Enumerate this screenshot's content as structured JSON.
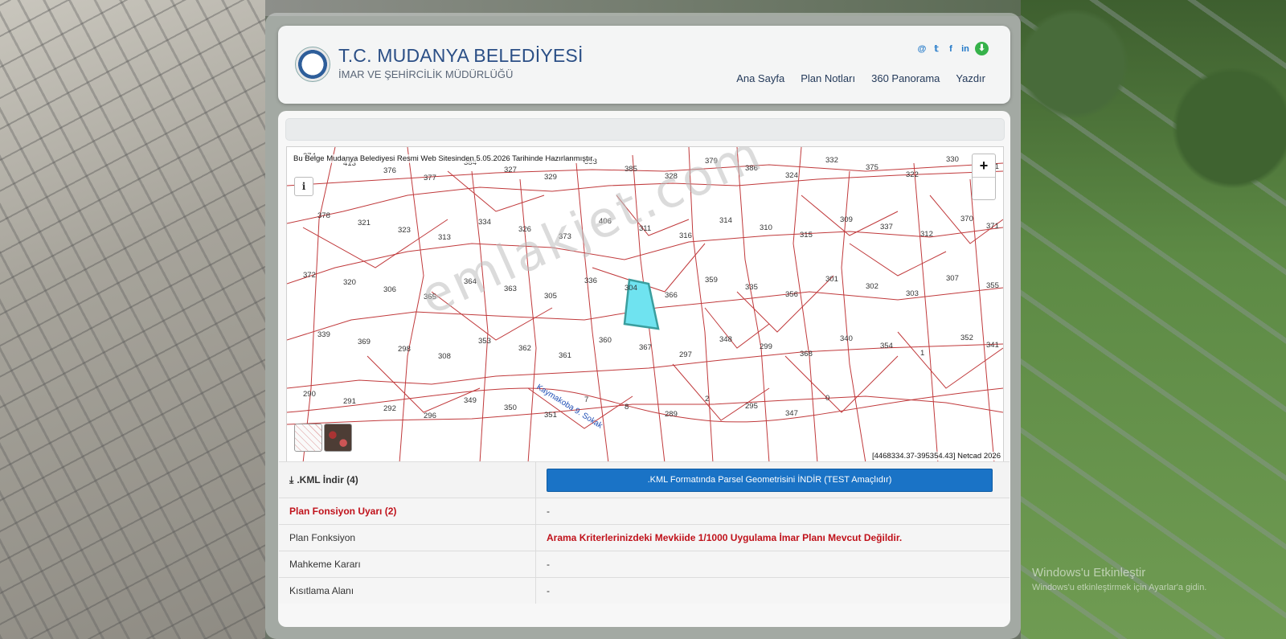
{
  "header": {
    "title": "T.C. MUDANYA BELEDİYESİ",
    "subtitle": "İMAR VE ŞEHİRCİLİK MÜDÜRLÜĞÜ",
    "social": [
      "@",
      "𝕥",
      "f",
      "in",
      "⬇"
    ],
    "nav": [
      "Ana Sayfa",
      "Plan Notları",
      "360 Panorama",
      "Yazdır"
    ]
  },
  "map": {
    "notice": "Bu Belge Mudanya Belediyesi Resmi Web Sitesinden 5.05.2026 Tarihinde Hazırlanmıştır.",
    "info_label": "i",
    "zoom_in": "+",
    "coords": "[4468334.37-395354.43] Netcad 2026",
    "watermark": "emlakjet.com",
    "street_label": "Kaymakoba 9. Sokak",
    "parcel_labels": [
      "374",
      "413",
      "376",
      "377",
      "384",
      "327",
      "329",
      "333",
      "385",
      "328",
      "379",
      "386",
      "324",
      "332",
      "375",
      "322",
      "330",
      "331",
      "378",
      "321",
      "323",
      "313",
      "334",
      "326",
      "373",
      "406",
      "311",
      "316",
      "314",
      "310",
      "315",
      "309",
      "337",
      "312",
      "370",
      "371",
      "372",
      "320",
      "306",
      "365",
      "364",
      "363",
      "305",
      "336",
      "304",
      "366",
      "359",
      "335",
      "356",
      "301",
      "302",
      "303",
      "307",
      "355",
      "339",
      "369",
      "298",
      "308",
      "353",
      "362",
      "361",
      "360",
      "367",
      "297",
      "348",
      "299",
      "368",
      "340",
      "354",
      "1",
      "352",
      "341",
      "290",
      "291",
      "292",
      "296",
      "349",
      "350",
      "351",
      "7",
      "8",
      "289",
      "2",
      "295",
      "347",
      "0"
    ]
  },
  "table": {
    "rows": [
      {
        "label": ".KML İndir (4)",
        "value": ".KML Formatında Parsel Geometrisini İNDİR (TEST Amaçlıdır)"
      },
      {
        "label": "Plan Fonsiyon Uyarı (2)",
        "value": "-"
      },
      {
        "label": "Plan Fonksiyon",
        "value": "Arama Kriterlerinizdeki Mevkiide 1/1000 Uygulama İmar Planı Mevcut Değildir."
      },
      {
        "label": "Mahkeme Kararı",
        "value": "-"
      },
      {
        "label": "Kısıtlama Alanı",
        "value": "-"
      }
    ]
  },
  "windows": {
    "line1": "Windows'u Etkinleştir",
    "line2": "Windows'u etkinleştirmek için Ayarlar'a gidin."
  },
  "colors": {
    "brand": "#2b4f86",
    "warning": "#c0121b",
    "button": "#1a73c6",
    "parcel_line": "#c0393b",
    "highlight": "#6fe3f0"
  }
}
